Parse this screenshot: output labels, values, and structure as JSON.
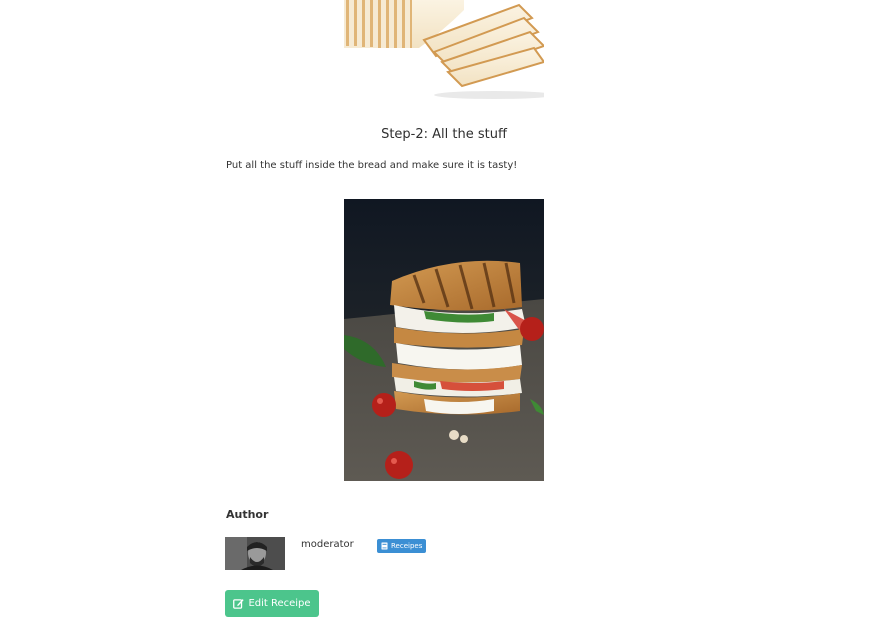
{
  "step2": {
    "title": "Step-2: All the stuff",
    "text": "Put all the stuff inside the bread and make sure it is tasty!"
  },
  "author": {
    "heading": "Author",
    "name": "moderator",
    "badge_label": "Receipes",
    "badge_icon": "book-icon",
    "badge_color": "#3b8fd4"
  },
  "actions": {
    "edit_label": "Edit Receipe",
    "edit_icon": "edit-icon",
    "edit_color": "#4cc58c"
  }
}
